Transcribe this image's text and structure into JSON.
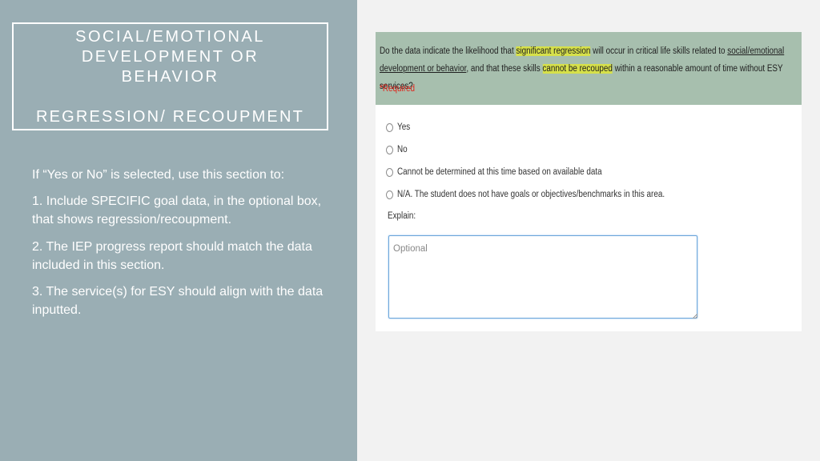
{
  "slide": {
    "title_line1": "SOCIAL/EMOTIONAL",
    "title_line2": "DEVELOPMENT OR",
    "title_line3": "BEHAVIOR",
    "subtitle": "REGRESSION/ RECOUPMENT",
    "intro": "If “Yes or No” is selected, use this section to:",
    "points": [
      "1.  Include SPECIFIC goal data, in the optional box,  that shows regression/recoupment.",
      "2.  The IEP progress report should match the data included in this section.",
      "3. The service(s) for ESY should align with the data inputted."
    ]
  },
  "form": {
    "question_part1": "Do the data indicate the likelihood that ",
    "question_highlight1": "significant regression",
    "question_part2": " will occur in critical life skills related to ",
    "question_underline": "social/emotional development or behavior",
    "question_part3": ", and that these skills ",
    "question_highlight2": "cannot be recouped",
    "question_part4": " within a reasonable amount of time without ESY services?",
    "required_label": "*Required",
    "options": [
      "Yes",
      "No",
      "Cannot be determined at this time based on available data",
      "N/A. The student does not have goals or objectives/benchmarks in this area."
    ],
    "explain_label": "Explain:",
    "explain_placeholder": "Optional"
  },
  "colors": {
    "left_panel": "#9aaeb4",
    "question_header": "#a7bfae",
    "highlight": "#d6e04a",
    "required": "#e0241b",
    "textarea_focus": "#6aa5da"
  }
}
